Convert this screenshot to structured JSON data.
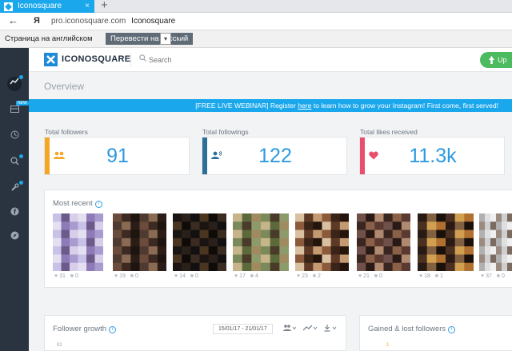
{
  "browser": {
    "tab_title": "Iconosquare",
    "tab_close": "×",
    "new_tab": "+",
    "back": "←",
    "home_logo": "Я",
    "url": "pro.iconosquare.com",
    "page_title": "Iconosquare"
  },
  "translate_bar": {
    "label": "Страница на английском",
    "button": "Перевести на русский",
    "dropdown": "▾",
    "close": "×"
  },
  "sidebar": {
    "new_badge": "NEW",
    "items": [
      "overview",
      "content",
      "schedule",
      "search",
      "tools",
      "facebook",
      "compass"
    ]
  },
  "topnav": {
    "logo": "ICONOSQUARE",
    "search_placeholder": "Search",
    "upgrade": "Up"
  },
  "page": {
    "title": "Overview"
  },
  "banner": {
    "prefix": "[FREE LIVE WEBINAR] Register ",
    "link": "here",
    "suffix": " to learn how to grow your Instagram! First come, first served!"
  },
  "stats": [
    {
      "label": "Total followers",
      "value": "91",
      "color": "#f5a623",
      "icon": "people-icon"
    },
    {
      "label": "Total followings",
      "value": "122",
      "color": "#2c6f98",
      "icon": "person-speaking-icon"
    },
    {
      "label": "Total likes received",
      "value": "11.3k",
      "color": "#e94f6c",
      "icon": "heart-icon"
    }
  ],
  "most_recent": {
    "title": "Most recent",
    "posts": [
      {
        "likes": "31",
        "comments": "0"
      },
      {
        "likes": "19",
        "comments": "0"
      },
      {
        "likes": "14",
        "comments": "0"
      },
      {
        "likes": "17",
        "comments": "4"
      },
      {
        "likes": "23",
        "comments": "2"
      },
      {
        "likes": "21",
        "comments": "0"
      },
      {
        "likes": "18",
        "comments": "1"
      },
      {
        "likes": "37",
        "comments": "0"
      }
    ]
  },
  "follower_growth": {
    "title": "Follower growth",
    "date_range": "15/01/17 - 21/01/17",
    "axis_top": "92"
  },
  "gained_lost": {
    "title": "Gained & lost followers",
    "axis_top": "1"
  }
}
